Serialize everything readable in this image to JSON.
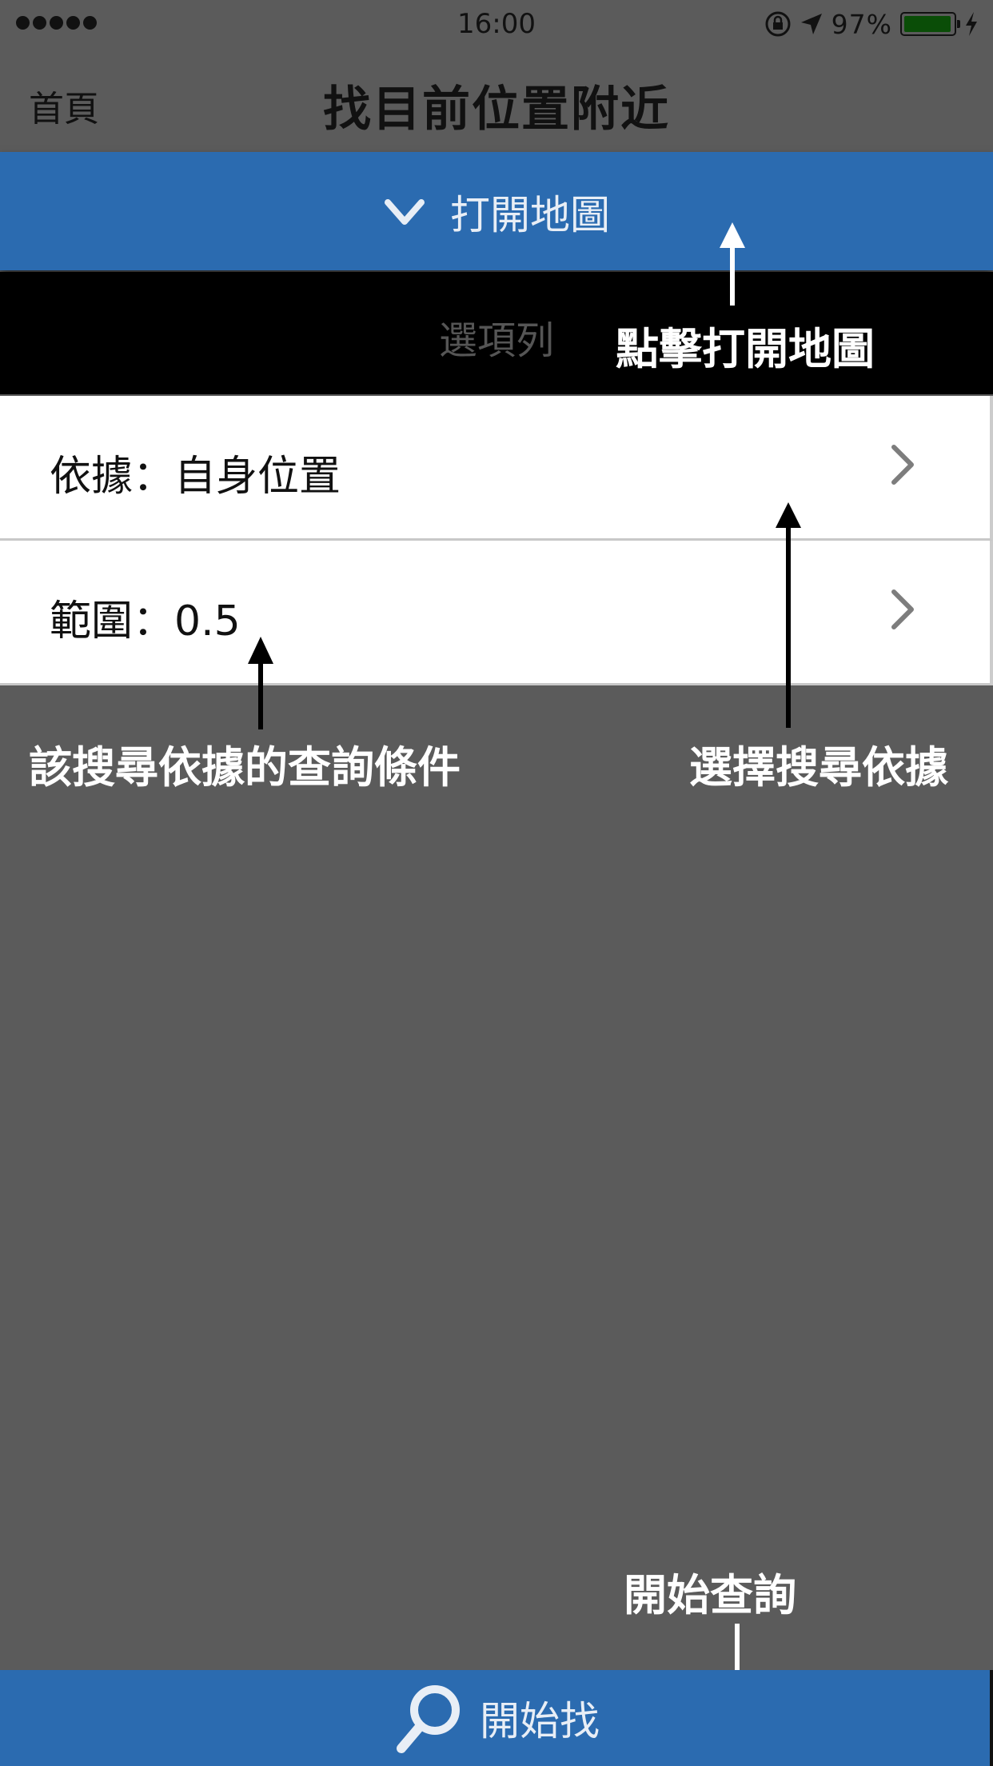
{
  "status_bar": {
    "time": "16:00",
    "battery_percent": "97%",
    "battery_level": 0.97,
    "icons": [
      "signal-dots-icon",
      "rotation-lock-icon",
      "location-arrow-icon",
      "battery-icon",
      "charging-bolt-icon"
    ]
  },
  "nav": {
    "back_label": "首頁",
    "title": "找目前位置附近"
  },
  "map_bar": {
    "label": "打開地圖",
    "icon": "chevron-down-icon"
  },
  "option_bar": {
    "label": "選項列"
  },
  "rows": [
    {
      "label": "依據：自身位置",
      "icon": "chevron-right-icon"
    },
    {
      "label": "範圍：0.5",
      "icon": "chevron-right-icon"
    }
  ],
  "annotations": {
    "open_map": "點擊打開地圖",
    "query_condition": "該搜尋依據的查詢條件",
    "choose_basis": "選擇搜尋依據",
    "start_query": "開始查詢"
  },
  "bottom_bar": {
    "label": "開始找",
    "icon": "search-icon"
  },
  "colors": {
    "background": "#5b5b5b",
    "accent_blue": "#2b6bb0",
    "option_bar": "#000000",
    "battery_fill": "#0a4d07"
  }
}
